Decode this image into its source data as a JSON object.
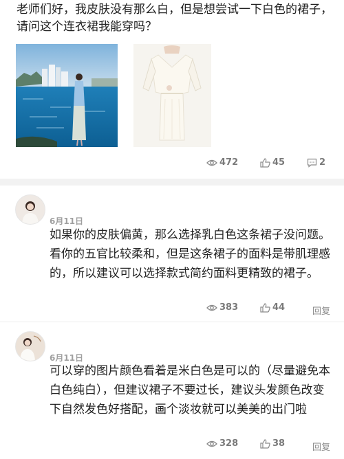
{
  "question": {
    "text": "老师们好，我皮肤没有那么白，但是想尝试一下白色的裙子，请问这个连衣裙我能穿吗？",
    "stats": {
      "views": "472",
      "likes": "45",
      "comments": "2"
    }
  },
  "answers": [
    {
      "date": "6月11日",
      "text": "如果你的皮肤偏黄，那么选择乳白色这条裙子没问题。看你的五官比较柔和，但是这条裙子的面料是带肌理感的，所以建议可以选择款式简约面料更精致的裙子。",
      "views": "383",
      "likes": "44",
      "reply_label": "回复"
    },
    {
      "date": "6月11日",
      "text": "可以穿的图片颜色看着是米白色是可以的（尽量避免本白色纯白），但建议裙子不要过长，建议头发颜色改变下自然发色好搭配，画个淡妆就可以美美的出门啦",
      "views": "328",
      "likes": "38",
      "reply_label": "回复"
    }
  ],
  "icons": {
    "views": "eye-icon",
    "likes": "thumbs-up-icon",
    "comments": "comment-icon"
  },
  "colors": {
    "stat_text": "#8a8a8a",
    "divider": "#f2f2f2"
  }
}
